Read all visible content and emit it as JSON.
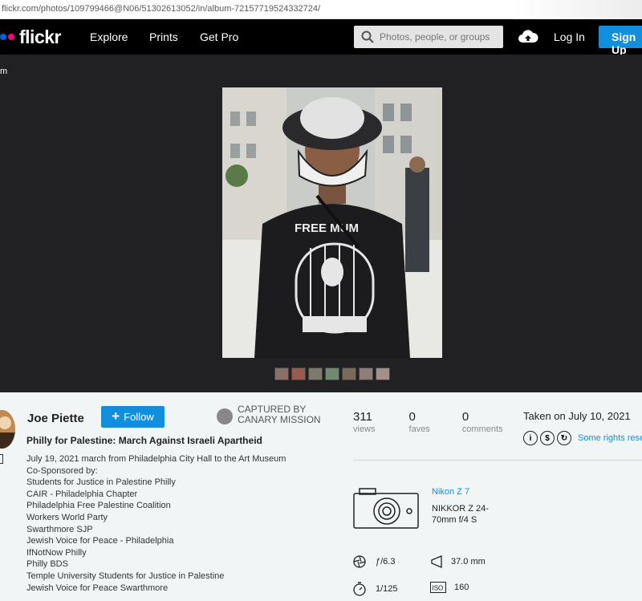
{
  "browser": {
    "url": "flickr.com/photos/109799466@N06/51302613052/in/album-72157719524332724/"
  },
  "nav": {
    "logo": "flickr",
    "links": [
      "Explore",
      "Prints",
      "Get Pro"
    ],
    "search_placeholder": "Photos, people, or groups",
    "login": "Log In",
    "signup": "Sign Up"
  },
  "viewer": {
    "back_label": "m",
    "thumb_count": 7
  },
  "photo_info": {
    "author": "Joe Piette",
    "follow_label": "Follow",
    "captured_line1": "CAPTURED BY",
    "captured_line2": "CANARY MISSION",
    "title": "Philly for Palestine: March Against Israeli Apartheid",
    "description": [
      "July 19, 2021 march from Philadelphia City Hall to the Art Museum",
      "Co-Sponsored by:",
      "Students for Justice in Palestine Philly",
      "CAIR - Philadelphia Chapter",
      "Philadelphia Free Palestine Coalition",
      "Workers World Party",
      "Swarthmore SJP",
      "Jewish Voice for Peace - Philadelphia",
      "IfNotNow Philly",
      "Philly BDS",
      "Temple University Students for Justice in Palestine",
      "Jewish Voice for Peace Swarthmore"
    ]
  },
  "stats": {
    "views": {
      "num": "311",
      "label": "views"
    },
    "faves": {
      "num": "0",
      "label": "faves"
    },
    "comments": {
      "num": "0",
      "label": "comments"
    }
  },
  "taken": "Taken on July 10, 2021",
  "rights": "Some rights reserved",
  "camera": {
    "model": "Nikon Z 7",
    "lens": "NIKKOR Z 24-70mm f/4 S",
    "aperture": "ƒ/6.3",
    "focal": "37.0 mm",
    "shutter": "1/125",
    "iso": "160"
  },
  "colors": {
    "accent": "#128fdc",
    "nav_bg": "#000000",
    "viewer_bg": "#212124",
    "info_bg": "#f2f5f6"
  }
}
